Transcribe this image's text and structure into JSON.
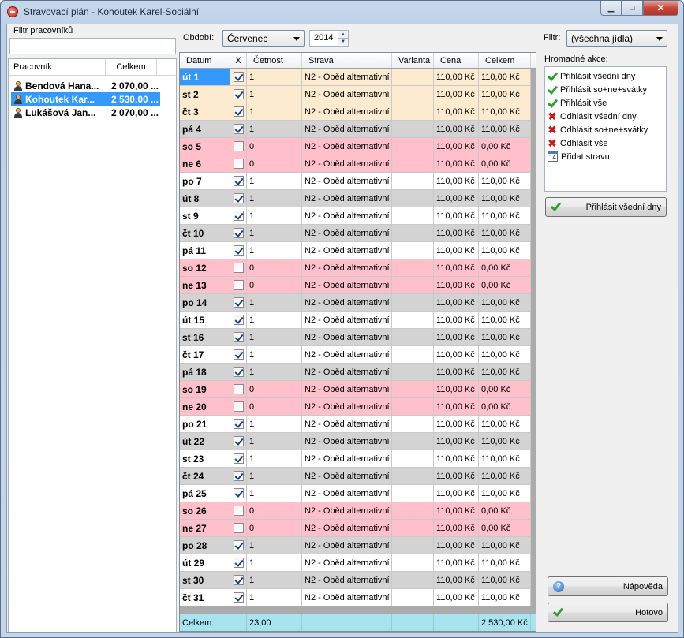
{
  "window": {
    "title": "Stravovací plán - Kohoutek Karel-Sociální",
    "minimize": "▁",
    "maximize": "□",
    "close": "✕"
  },
  "left": {
    "filter_label": "Filtr pracovníků",
    "filter_value": "",
    "col_name": "Pracovník",
    "col_total": "Celkem",
    "employees": [
      {
        "name": "Bendová Hana...",
        "total": "2 070,00 ..."
      },
      {
        "name": "Kohoutek Kar...",
        "total": "2 530,00 ..."
      },
      {
        "name": "Lukášová Jan...",
        "total": "2 070,00 ..."
      }
    ]
  },
  "top": {
    "obdobi_label": "Období:",
    "month": "Červenec",
    "year": "2014",
    "filtr_label": "Filtr:",
    "filtr_value": "(všechna jídla)"
  },
  "grid": {
    "headers": {
      "datum": "Datum",
      "x": "X",
      "cetnost": "Četnost",
      "strava": "Strava",
      "varianta": "Varianta",
      "cena": "Cena",
      "celkem": "Celkem"
    },
    "rows": [
      {
        "datum": "út 1",
        "x": true,
        "cetnost": "1",
        "strava": "N2 - Oběd alternativní",
        "varianta": "",
        "cena": "110,00 Kč",
        "celkem": "110,00 Kč",
        "kind": "top"
      },
      {
        "datum": "st 2",
        "x": true,
        "cetnost": "1",
        "strava": "N2 - Oběd alternativní",
        "varianta": "",
        "cena": "110,00 Kč",
        "celkem": "110,00 Kč",
        "kind": "top"
      },
      {
        "datum": "čt 3",
        "x": true,
        "cetnost": "1",
        "strava": "N2 - Oběd alternativní",
        "varianta": "",
        "cena": "110,00 Kč",
        "celkem": "110,00 Kč",
        "kind": "top"
      },
      {
        "datum": "pá 4",
        "x": true,
        "cetnost": "1",
        "strava": "N2 - Oběd alternativní",
        "varianta": "",
        "cena": "110,00 Kč",
        "celkem": "110,00 Kč",
        "kind": "odd"
      },
      {
        "datum": "so 5",
        "x": false,
        "cetnost": "0",
        "strava": "N2 - Oběd alternativní",
        "varianta": "",
        "cena": "110,00 Kč",
        "celkem": "0,00 Kč",
        "kind": "weekend"
      },
      {
        "datum": "ne 6",
        "x": false,
        "cetnost": "0",
        "strava": "N2 - Oběd alternativní",
        "varianta": "",
        "cena": "110,00 Kč",
        "celkem": "0,00 Kč",
        "kind": "weekend"
      },
      {
        "datum": "po 7",
        "x": true,
        "cetnost": "1",
        "strava": "N2 - Oběd alternativní",
        "varianta": "",
        "cena": "110,00 Kč",
        "celkem": "110,00 Kč",
        "kind": "even"
      },
      {
        "datum": "út 8",
        "x": true,
        "cetnost": "1",
        "strava": "N2 - Oběd alternativní",
        "varianta": "",
        "cena": "110,00 Kč",
        "celkem": "110,00 Kč",
        "kind": "odd"
      },
      {
        "datum": "st 9",
        "x": true,
        "cetnost": "1",
        "strava": "N2 - Oběd alternativní",
        "varianta": "",
        "cena": "110,00 Kč",
        "celkem": "110,00 Kč",
        "kind": "even"
      },
      {
        "datum": "čt 10",
        "x": true,
        "cetnost": "1",
        "strava": "N2 - Oběd alternativní",
        "varianta": "",
        "cena": "110,00 Kč",
        "celkem": "110,00 Kč",
        "kind": "odd"
      },
      {
        "datum": "pá 11",
        "x": true,
        "cetnost": "1",
        "strava": "N2 - Oběd alternativní",
        "varianta": "",
        "cena": "110,00 Kč",
        "celkem": "110,00 Kč",
        "kind": "even"
      },
      {
        "datum": "so 12",
        "x": false,
        "cetnost": "0",
        "strava": "N2 - Oběd alternativní",
        "varianta": "",
        "cena": "110,00 Kč",
        "celkem": "0,00 Kč",
        "kind": "weekend"
      },
      {
        "datum": "ne 13",
        "x": false,
        "cetnost": "0",
        "strava": "N2 - Oběd alternativní",
        "varianta": "",
        "cena": "110,00 Kč",
        "celkem": "0,00 Kč",
        "kind": "weekend"
      },
      {
        "datum": "po 14",
        "x": true,
        "cetnost": "1",
        "strava": "N2 - Oběd alternativní",
        "varianta": "",
        "cena": "110,00 Kč",
        "celkem": "110,00 Kč",
        "kind": "odd"
      },
      {
        "datum": "út 15",
        "x": true,
        "cetnost": "1",
        "strava": "N2 - Oběd alternativní",
        "varianta": "",
        "cena": "110,00 Kč",
        "celkem": "110,00 Kč",
        "kind": "even"
      },
      {
        "datum": "st 16",
        "x": true,
        "cetnost": "1",
        "strava": "N2 - Oběd alternativní",
        "varianta": "",
        "cena": "110,00 Kč",
        "celkem": "110,00 Kč",
        "kind": "odd"
      },
      {
        "datum": "čt 17",
        "x": true,
        "cetnost": "1",
        "strava": "N2 - Oběd alternativní",
        "varianta": "",
        "cena": "110,00 Kč",
        "celkem": "110,00 Kč",
        "kind": "even"
      },
      {
        "datum": "pá 18",
        "x": true,
        "cetnost": "1",
        "strava": "N2 - Oběd alternativní",
        "varianta": "",
        "cena": "110,00 Kč",
        "celkem": "110,00 Kč",
        "kind": "odd"
      },
      {
        "datum": "so 19",
        "x": false,
        "cetnost": "0",
        "strava": "N2 - Oběd alternativní",
        "varianta": "",
        "cena": "110,00 Kč",
        "celkem": "0,00 Kč",
        "kind": "weekend"
      },
      {
        "datum": "ne 20",
        "x": false,
        "cetnost": "0",
        "strava": "N2 - Oběd alternativní",
        "varianta": "",
        "cena": "110,00 Kč",
        "celkem": "0,00 Kč",
        "kind": "weekend"
      },
      {
        "datum": "po 21",
        "x": true,
        "cetnost": "1",
        "strava": "N2 - Oběd alternativní",
        "varianta": "",
        "cena": "110,00 Kč",
        "celkem": "110,00 Kč",
        "kind": "even"
      },
      {
        "datum": "út 22",
        "x": true,
        "cetnost": "1",
        "strava": "N2 - Oběd alternativní",
        "varianta": "",
        "cena": "110,00 Kč",
        "celkem": "110,00 Kč",
        "kind": "odd"
      },
      {
        "datum": "st 23",
        "x": true,
        "cetnost": "1",
        "strava": "N2 - Oběd alternativní",
        "varianta": "",
        "cena": "110,00 Kč",
        "celkem": "110,00 Kč",
        "kind": "even"
      },
      {
        "datum": "čt 24",
        "x": true,
        "cetnost": "1",
        "strava": "N2 - Oběd alternativní",
        "varianta": "",
        "cena": "110,00 Kč",
        "celkem": "110,00 Kč",
        "kind": "odd"
      },
      {
        "datum": "pá 25",
        "x": true,
        "cetnost": "1",
        "strava": "N2 - Oběd alternativní",
        "varianta": "",
        "cena": "110,00 Kč",
        "celkem": "110,00 Kč",
        "kind": "even"
      },
      {
        "datum": "so 26",
        "x": false,
        "cetnost": "0",
        "strava": "N2 - Oběd alternativní",
        "varianta": "",
        "cena": "110,00 Kč",
        "celkem": "0,00 Kč",
        "kind": "weekend"
      },
      {
        "datum": "ne 27",
        "x": false,
        "cetnost": "0",
        "strava": "N2 - Oběd alternativní",
        "varianta": "",
        "cena": "110,00 Kč",
        "celkem": "0,00 Kč",
        "kind": "weekend"
      },
      {
        "datum": "po 28",
        "x": true,
        "cetnost": "1",
        "strava": "N2 - Oběd alternativní",
        "varianta": "",
        "cena": "110,00 Kč",
        "celkem": "110,00 Kč",
        "kind": "odd"
      },
      {
        "datum": "út 29",
        "x": true,
        "cetnost": "1",
        "strava": "N2 - Oběd alternativní",
        "varianta": "",
        "cena": "110,00 Kč",
        "celkem": "110,00 Kč",
        "kind": "even"
      },
      {
        "datum": "st 30",
        "x": true,
        "cetnost": "1",
        "strava": "N2 - Oběd alternativní",
        "varianta": "",
        "cena": "110,00 Kč",
        "celkem": "110,00 Kč",
        "kind": "odd"
      },
      {
        "datum": "čt 31",
        "x": true,
        "cetnost": "1",
        "strava": "N2 - Oběd alternativní",
        "varianta": "",
        "cena": "110,00 Kč",
        "celkem": "110,00 Kč",
        "kind": "even"
      }
    ],
    "footer": {
      "label": "Celkem:",
      "cetnost": "23,00",
      "celkem": "2 530,00 Kč"
    }
  },
  "right": {
    "hromadne_label": "Hromadné akce:",
    "actions": [
      {
        "label": "Přihlásit všední dny",
        "icon": "check-icon"
      },
      {
        "label": "Přihlásit so+ne+svátky",
        "icon": "check-icon"
      },
      {
        "label": "Přihlásit vše",
        "icon": "check-icon"
      },
      {
        "label": "Odhlásit všední dny",
        "icon": "cross-icon"
      },
      {
        "label": "Odhlásit so+ne+svátky",
        "icon": "cross-icon"
      },
      {
        "label": "Odhlásit vše",
        "icon": "cross-icon"
      },
      {
        "label": "Přidat stravu",
        "icon": "calendar-icon",
        "badge": "14"
      }
    ],
    "apply_button": "Přihlásit všední dny",
    "help_button": "Nápověda",
    "done_button": "Hotovo"
  },
  "colors": {
    "weekend": "#ffc0cb",
    "odd": "#d3d3d3",
    "selected": "#3399ff",
    "footer": "#a8e4ef",
    "first_rows": "#fdebd0"
  }
}
